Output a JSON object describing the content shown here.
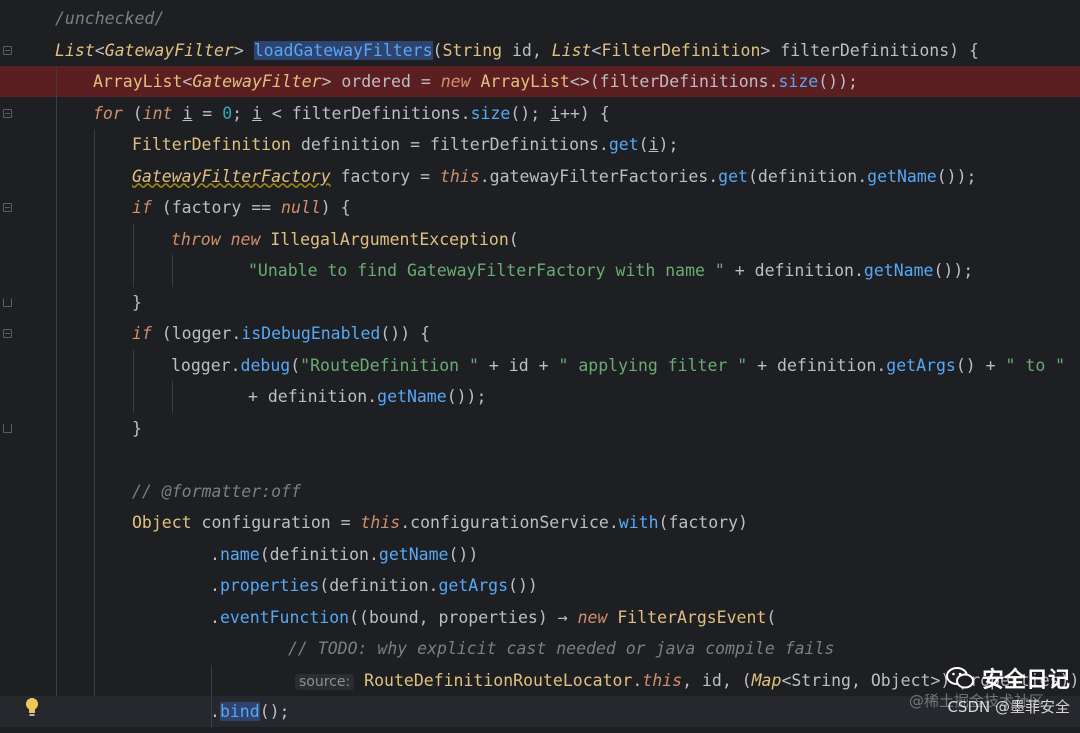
{
  "editor": {
    "lines": [
      [
        [
          "cmt",
          "/unchecked/"
        ]
      ],
      [
        [
          "itype",
          "List"
        ],
        [
          "",
          "<"
        ],
        [
          "itype",
          "GatewayFilter"
        ],
        [
          "",
          "> "
        ],
        [
          "method hl",
          "loadGatewayFilters"
        ],
        [
          "",
          "("
        ],
        [
          "type",
          "String"
        ],
        [
          "",
          " "
        ],
        [
          "param",
          "id"
        ],
        [
          "",
          ", "
        ],
        [
          "itype",
          "List"
        ],
        [
          "",
          "<"
        ],
        [
          "type",
          "FilterDefinition"
        ],
        [
          "",
          "> "
        ],
        [
          "param",
          "filterDefinitions"
        ],
        [
          "",
          ") {"
        ]
      ],
      [
        [
          "type",
          "ArrayList"
        ],
        [
          "",
          "<"
        ],
        [
          "itype",
          "GatewayFilter"
        ],
        [
          "",
          "> ordered = "
        ],
        [
          "kwi",
          "new"
        ],
        [
          "",
          " "
        ],
        [
          "type",
          "ArrayList"
        ],
        [
          "",
          "<>("
        ],
        [
          "param",
          "filterDefinitions"
        ],
        [
          "",
          "."
        ],
        [
          "method",
          "size"
        ],
        [
          "",
          "());"
        ]
      ],
      [
        [
          "kwi",
          "for"
        ],
        [
          "",
          " ("
        ],
        [
          "kwi",
          "int"
        ],
        [
          "",
          " "
        ],
        [
          "und",
          "i"
        ],
        [
          "",
          " = "
        ],
        [
          "num",
          "0"
        ],
        [
          "",
          "; "
        ],
        [
          "und",
          "i"
        ],
        [
          "",
          " < "
        ],
        [
          "param",
          "filterDefinitions"
        ],
        [
          "",
          "."
        ],
        [
          "method",
          "size"
        ],
        [
          "",
          "(); "
        ],
        [
          "und",
          "i"
        ],
        [
          "",
          "++) {"
        ]
      ],
      [
        [
          "type",
          "FilterDefinition"
        ],
        [
          "",
          " definition = "
        ],
        [
          "param",
          "filterDefinitions"
        ],
        [
          "",
          "."
        ],
        [
          "method",
          "get"
        ],
        [
          "",
          "("
        ],
        [
          "und",
          "i"
        ],
        [
          "",
          ");"
        ]
      ],
      [
        [
          "itype uline",
          "GatewayFilterFactory"
        ],
        [
          "",
          " factory = "
        ],
        [
          "kwi",
          "this"
        ],
        [
          "",
          ".gatewayFilterFactories."
        ],
        [
          "method",
          "get"
        ],
        [
          "",
          "(definition."
        ],
        [
          "method",
          "getName"
        ],
        [
          "",
          "());"
        ]
      ],
      [
        [
          "kwi",
          "if"
        ],
        [
          "",
          " (factory == "
        ],
        [
          "kwi",
          "null"
        ],
        [
          "",
          ") {"
        ]
      ],
      [
        [
          "kwi",
          "throw"
        ],
        [
          "",
          " "
        ],
        [
          "kwi",
          "new"
        ],
        [
          "",
          " "
        ],
        [
          "type",
          "IllegalArgumentException"
        ],
        [
          "",
          "("
        ]
      ],
      [
        [
          "str",
          "\"Unable to find GatewayFilterFactory with name \""
        ],
        [
          "",
          " + definition."
        ],
        [
          "method",
          "getName"
        ],
        [
          "",
          "());"
        ]
      ],
      [
        [
          "",
          "}"
        ]
      ],
      [
        [
          "kwi",
          "if"
        ],
        [
          "",
          " (logger."
        ],
        [
          "method",
          "isDebugEnabled"
        ],
        [
          "",
          "()) {"
        ]
      ],
      [
        [
          "",
          "logger."
        ],
        [
          "method",
          "debug"
        ],
        [
          "",
          "("
        ],
        [
          "str",
          "\"RouteDefinition \""
        ],
        [
          "",
          " + "
        ],
        [
          "param",
          "id"
        ],
        [
          "",
          " + "
        ],
        [
          "str",
          "\" applying filter \""
        ],
        [
          "",
          " + definition."
        ],
        [
          "method",
          "getArgs"
        ],
        [
          "",
          "() + "
        ],
        [
          "str",
          "\" to \""
        ]
      ],
      [
        [
          "",
          "+ definition."
        ],
        [
          "method",
          "getName"
        ],
        [
          "",
          "());"
        ]
      ],
      [
        [
          "",
          "}"
        ]
      ],
      [],
      [
        [
          "cmt",
          "// @formatter:off"
        ]
      ],
      [
        [
          "type",
          "Object"
        ],
        [
          "",
          " configuration = "
        ],
        [
          "kwi",
          "this"
        ],
        [
          "",
          ".configurationService."
        ],
        [
          "method",
          "with"
        ],
        [
          "",
          "(factory)"
        ]
      ],
      [
        [
          "",
          "."
        ],
        [
          "method",
          "name"
        ],
        [
          "",
          "(definition."
        ],
        [
          "method",
          "getName"
        ],
        [
          "",
          "())"
        ]
      ],
      [
        [
          "",
          "."
        ],
        [
          "method",
          "properties"
        ],
        [
          "",
          "(definition."
        ],
        [
          "method",
          "getArgs"
        ],
        [
          "",
          "())"
        ]
      ],
      [
        [
          "",
          "."
        ],
        [
          "method",
          "eventFunction"
        ],
        [
          "",
          "(("
        ],
        [
          "param",
          "bound"
        ],
        [
          "",
          ", "
        ],
        [
          "param",
          "properties"
        ],
        [
          "",
          ") → "
        ],
        [
          "kwi",
          "new"
        ],
        [
          "",
          " "
        ],
        [
          "type",
          "FilterArgsEvent"
        ],
        [
          "",
          "("
        ]
      ],
      [
        [
          "cmt",
          "// TODO: why explicit cast needed or java compile fails"
        ]
      ],
      [
        [
          "hint",
          "source:"
        ],
        [
          "",
          " "
        ],
        [
          "type",
          "RouteDefinitionRouteLocator"
        ],
        [
          "",
          "."
        ],
        [
          "kwi",
          "this"
        ],
        [
          "",
          ", "
        ],
        [
          "param",
          "id"
        ],
        [
          "",
          ", ("
        ],
        [
          "itype",
          "Map"
        ],
        [
          "",
          "<String, Object>) properties))"
        ]
      ],
      [
        [
          "",
          "."
        ],
        [
          "method hl",
          "bind"
        ],
        [
          "",
          "();"
        ]
      ]
    ]
  },
  "watermark": {
    "title": "安全日记",
    "subtitle": "CSDN @墨菲安全",
    "faint": "@稀土掘金技术社区"
  }
}
